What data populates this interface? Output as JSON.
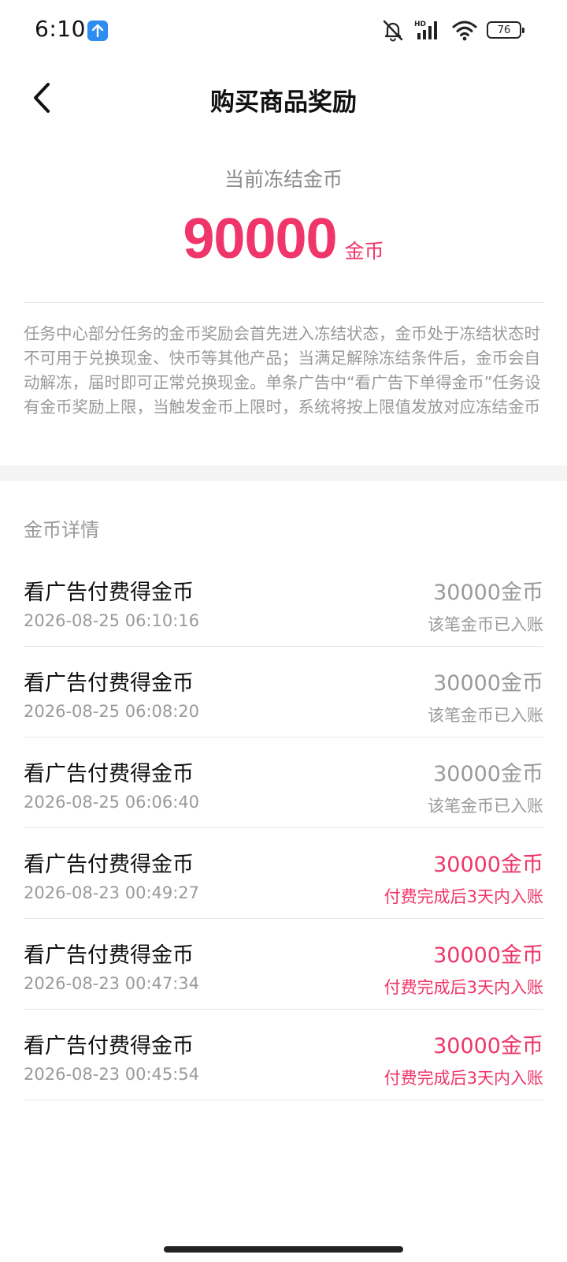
{
  "status_bar": {
    "time": "6:10",
    "battery": "76",
    "icons": [
      "upload-icon",
      "mute-icon",
      "hd-signal-icon",
      "wifi-icon",
      "battery-icon"
    ]
  },
  "header": {
    "title": "购买商品奖励",
    "back_icon": "chevron-left-icon"
  },
  "summary": {
    "label": "当前冻结金币",
    "amount": "90000",
    "unit": "金币"
  },
  "note": "任务中心部分任务的金币奖励会首先进入冻结状态，金币处于冻结状态时不可用于兑换现金、快币等其他产品；当满足解除冻结条件后，金币会自动解冻，届时即可正常兑换现金。单条广告中“看广告下单得金币”任务设有金币奖励上限，当触发金币上限时，系统将按上限值发放对应冻结金币",
  "section_title": "金币详情",
  "records": [
    {
      "title": "看广告付费得金币",
      "time": "2026-08-25 06:10:16",
      "amount": "30000金币",
      "status": "该笔金币已入账"
    },
    {
      "title": "看广告付费得金币",
      "time": "2026-08-25 06:08:20",
      "amount": "30000金币",
      "status": "该笔金币已入账"
    },
    {
      "title": "看广告付费得金币",
      "time": "2026-08-25 06:06:40",
      "amount": "30000金币",
      "status": "该笔金币已入账"
    },
    {
      "title": "看广告付费得金币",
      "time": "2026-08-23 00:49:27",
      "amount": "30000金币",
      "status": "付费完成后3天内入账"
    },
    {
      "title": "看广告付费得金币",
      "time": "2026-08-23 00:47:34",
      "amount": "30000金币",
      "status": "付费完成后3天内入账"
    },
    {
      "title": "看广告付费得金币",
      "time": "2026-08-23 00:45:54",
      "amount": "30000金币",
      "status": "付费完成后3天内入账"
    }
  ],
  "colors": {
    "accent": "#f0356a",
    "muted": "#9a9a9a",
    "upload_badge": "#2d8cf0"
  }
}
